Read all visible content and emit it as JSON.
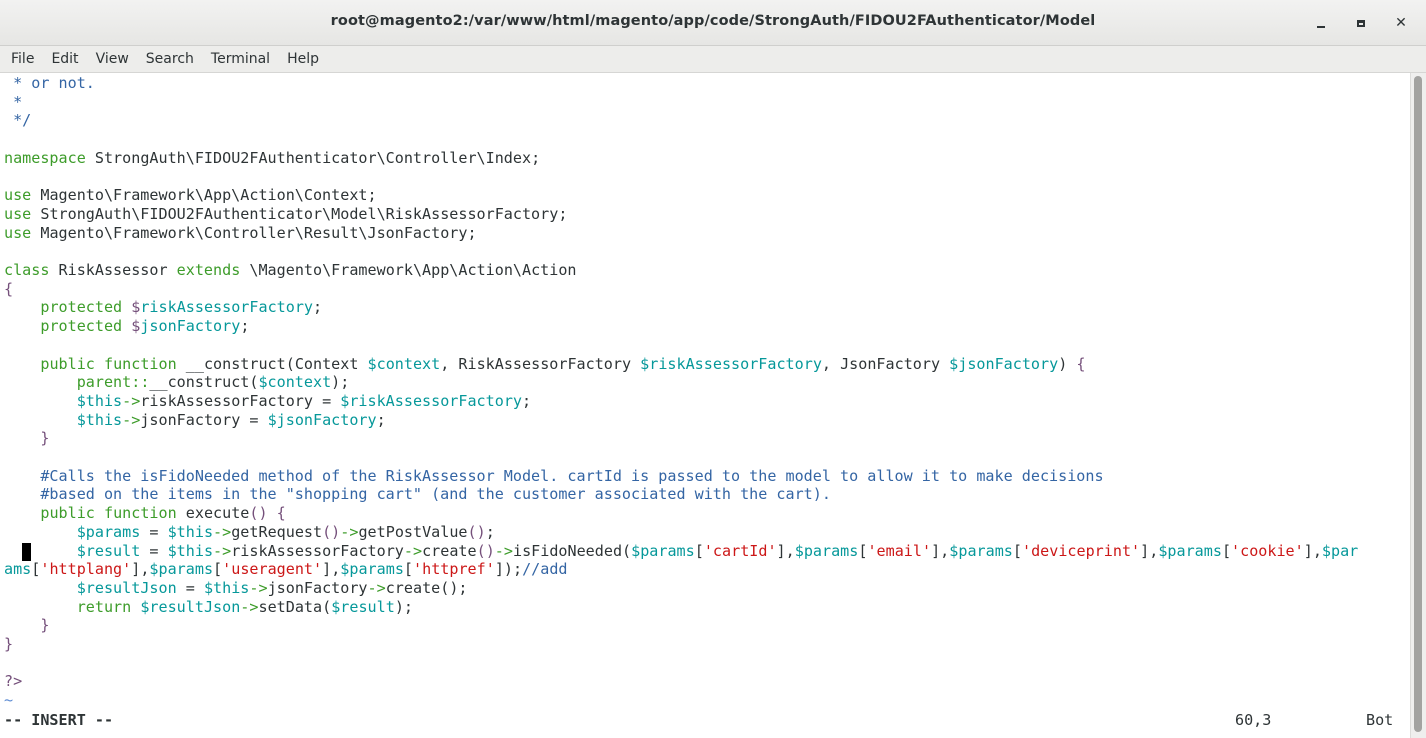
{
  "window": {
    "title": "root@magento2:/var/www/html/magento/app/code/StrongAuth/FIDOU2FAuthenticator/Model"
  },
  "menu": [
    {
      "label": "File"
    },
    {
      "label": "Edit"
    },
    {
      "label": "View"
    },
    {
      "label": "Search"
    },
    {
      "label": "Terminal"
    },
    {
      "label": "Help"
    }
  ],
  "colors": {
    "default": "#2e3436",
    "comment": "#3465a4",
    "keyword": "#3d9c2a",
    "variable": "#06989a",
    "string": "#cc1717",
    "brace": "#75507b",
    "tilde": "#5f8dd3"
  },
  "editor": {
    "lines": [
      [
        {
          "t": " * or not.",
          "c": "comment"
        }
      ],
      [
        {
          "t": " *",
          "c": "comment"
        }
      ],
      [
        {
          "t": " */",
          "c": "comment"
        }
      ],
      [],
      [
        {
          "t": "namespace",
          "c": "keyword"
        },
        {
          "t": " StrongAuth\\FIDOU2FAuthenticator\\Controller\\Index;",
          "c": "default"
        }
      ],
      [],
      [
        {
          "t": "use",
          "c": "keyword"
        },
        {
          "t": " Magento\\Framework\\App\\Action\\Context;",
          "c": "default"
        }
      ],
      [
        {
          "t": "use",
          "c": "keyword"
        },
        {
          "t": " StrongAuth\\FIDOU2FAuthenticator\\Model\\RiskAssessorFactory;",
          "c": "default"
        }
      ],
      [
        {
          "t": "use",
          "c": "keyword"
        },
        {
          "t": " Magento\\Framework\\Controller\\Result\\JsonFactory;",
          "c": "default"
        }
      ],
      [],
      [
        {
          "t": "class",
          "c": "keyword"
        },
        {
          "t": " RiskAssessor ",
          "c": "default"
        },
        {
          "t": "extends",
          "c": "keyword"
        },
        {
          "t": " \\Magento\\Framework\\App\\Action\\Action",
          "c": "default"
        }
      ],
      [
        {
          "t": "{",
          "c": "brace"
        }
      ],
      [
        {
          "t": "    ",
          "c": "default"
        },
        {
          "t": "protected",
          "c": "keyword"
        },
        {
          "t": " ",
          "c": "default"
        },
        {
          "t": "$",
          "c": "brace"
        },
        {
          "t": "riskAssessorFactory",
          "c": "variable"
        },
        {
          "t": ";",
          "c": "default"
        }
      ],
      [
        {
          "t": "    ",
          "c": "default"
        },
        {
          "t": "protected",
          "c": "keyword"
        },
        {
          "t": " ",
          "c": "default"
        },
        {
          "t": "$",
          "c": "brace"
        },
        {
          "t": "jsonFactory",
          "c": "variable"
        },
        {
          "t": ";",
          "c": "default"
        }
      ],
      [],
      [
        {
          "t": "    ",
          "c": "default"
        },
        {
          "t": "public",
          "c": "keyword"
        },
        {
          "t": " ",
          "c": "default"
        },
        {
          "t": "function",
          "c": "keyword"
        },
        {
          "t": " __construct(Context ",
          "c": "default"
        },
        {
          "t": "$context",
          "c": "variable"
        },
        {
          "t": ", RiskAssessorFactory ",
          "c": "default"
        },
        {
          "t": "$riskAssessorFactory",
          "c": "variable"
        },
        {
          "t": ", JsonFactory ",
          "c": "default"
        },
        {
          "t": "$jsonFactory",
          "c": "variable"
        },
        {
          "t": ") ",
          "c": "default"
        },
        {
          "t": "{",
          "c": "brace"
        }
      ],
      [
        {
          "t": "        ",
          "c": "default"
        },
        {
          "t": "parent::",
          "c": "keyword"
        },
        {
          "t": "__construct(",
          "c": "default"
        },
        {
          "t": "$context",
          "c": "variable"
        },
        {
          "t": ");",
          "c": "default"
        }
      ],
      [
        {
          "t": "        ",
          "c": "default"
        },
        {
          "t": "$this",
          "c": "variable"
        },
        {
          "t": "->",
          "c": "keyword"
        },
        {
          "t": "riskAssessorFactory = ",
          "c": "default"
        },
        {
          "t": "$riskAssessorFactory",
          "c": "variable"
        },
        {
          "t": ";",
          "c": "default"
        }
      ],
      [
        {
          "t": "        ",
          "c": "default"
        },
        {
          "t": "$this",
          "c": "variable"
        },
        {
          "t": "->",
          "c": "keyword"
        },
        {
          "t": "jsonFactory = ",
          "c": "default"
        },
        {
          "t": "$jsonFactory",
          "c": "variable"
        },
        {
          "t": ";",
          "c": "default"
        }
      ],
      [
        {
          "t": "    ",
          "c": "default"
        },
        {
          "t": "}",
          "c": "brace"
        }
      ],
      [],
      [
        {
          "t": "    #Calls the isFidoNeeded method of the RiskAssessor Model. cartId is passed to the model to allow it to make decisions",
          "c": "comment"
        }
      ],
      [
        {
          "t": "    #based on the items in the \"shopping cart\" (and the customer associated with the cart).",
          "c": "comment"
        }
      ],
      [
        {
          "t": "    ",
          "c": "default"
        },
        {
          "t": "public",
          "c": "keyword"
        },
        {
          "t": " ",
          "c": "default"
        },
        {
          "t": "function",
          "c": "keyword"
        },
        {
          "t": " execute",
          "c": "default"
        },
        {
          "t": "() ",
          "c": "brace"
        },
        {
          "t": "{",
          "c": "brace"
        }
      ],
      [
        {
          "t": "        ",
          "c": "default"
        },
        {
          "t": "$params",
          "c": "variable"
        },
        {
          "t": " = ",
          "c": "default"
        },
        {
          "t": "$this",
          "c": "variable"
        },
        {
          "t": "->",
          "c": "keyword"
        },
        {
          "t": "getRequest",
          "c": "default"
        },
        {
          "t": "()",
          "c": "brace"
        },
        {
          "t": "->",
          "c": "keyword"
        },
        {
          "t": "getPostValue",
          "c": "default"
        },
        {
          "t": "()",
          "c": "brace"
        },
        {
          "t": ";",
          "c": "default"
        }
      ],
      [
        {
          "t": "        ",
          "c": "default"
        },
        {
          "t": "$result",
          "c": "variable"
        },
        {
          "t": " = ",
          "c": "default"
        },
        {
          "t": "$this",
          "c": "variable"
        },
        {
          "t": "->",
          "c": "keyword"
        },
        {
          "t": "riskAssessorFactory",
          "c": "default"
        },
        {
          "t": "->",
          "c": "keyword"
        },
        {
          "t": "create",
          "c": "default"
        },
        {
          "t": "()",
          "c": "brace"
        },
        {
          "t": "->",
          "c": "keyword"
        },
        {
          "t": "isFidoNeeded(",
          "c": "default"
        },
        {
          "t": "$params",
          "c": "variable"
        },
        {
          "t": "[",
          "c": "default"
        },
        {
          "t": "'cartId'",
          "c": "string"
        },
        {
          "t": "],",
          "c": "default"
        },
        {
          "t": "$params",
          "c": "variable"
        },
        {
          "t": "[",
          "c": "default"
        },
        {
          "t": "'email'",
          "c": "string"
        },
        {
          "t": "],",
          "c": "default"
        },
        {
          "t": "$params",
          "c": "variable"
        },
        {
          "t": "[",
          "c": "default"
        },
        {
          "t": "'deviceprint'",
          "c": "string"
        },
        {
          "t": "],",
          "c": "default"
        },
        {
          "t": "$params",
          "c": "variable"
        },
        {
          "t": "[",
          "c": "default"
        },
        {
          "t": "'cookie'",
          "c": "string"
        },
        {
          "t": "],",
          "c": "default"
        },
        {
          "t": "$par",
          "c": "variable"
        }
      ],
      [
        {
          "t": "ams",
          "c": "variable"
        },
        {
          "t": "[",
          "c": "default"
        },
        {
          "t": "'httplang'",
          "c": "string"
        },
        {
          "t": "],",
          "c": "default"
        },
        {
          "t": "$params",
          "c": "variable"
        },
        {
          "t": "[",
          "c": "default"
        },
        {
          "t": "'useragent'",
          "c": "string"
        },
        {
          "t": "],",
          "c": "default"
        },
        {
          "t": "$params",
          "c": "variable"
        },
        {
          "t": "[",
          "c": "default"
        },
        {
          "t": "'httpref'",
          "c": "string"
        },
        {
          "t": "]);",
          "c": "default"
        },
        {
          "t": "//add",
          "c": "comment"
        }
      ],
      [
        {
          "t": "        ",
          "c": "default"
        },
        {
          "t": "$resultJson",
          "c": "variable"
        },
        {
          "t": " = ",
          "c": "default"
        },
        {
          "t": "$this",
          "c": "variable"
        },
        {
          "t": "->",
          "c": "keyword"
        },
        {
          "t": "jsonFactory",
          "c": "default"
        },
        {
          "t": "->",
          "c": "keyword"
        },
        {
          "t": "create",
          "c": "default"
        },
        {
          "t": "();",
          "c": "default"
        }
      ],
      [
        {
          "t": "        ",
          "c": "default"
        },
        {
          "t": "return",
          "c": "keyword"
        },
        {
          "t": " ",
          "c": "default"
        },
        {
          "t": "$resultJson",
          "c": "variable"
        },
        {
          "t": "->",
          "c": "keyword"
        },
        {
          "t": "setData(",
          "c": "default"
        },
        {
          "t": "$result",
          "c": "variable"
        },
        {
          "t": ");",
          "c": "default"
        }
      ],
      [
        {
          "t": "    ",
          "c": "default"
        },
        {
          "t": "}",
          "c": "brace"
        }
      ],
      [
        {
          "t": "}",
          "c": "brace"
        }
      ],
      [],
      [
        {
          "t": "?>",
          "c": "brace"
        }
      ],
      [
        {
          "t": "~",
          "c": "tilde"
        }
      ]
    ]
  },
  "status": {
    "mode": "-- INSERT --",
    "position": "60,3",
    "scroll": "Bot"
  }
}
